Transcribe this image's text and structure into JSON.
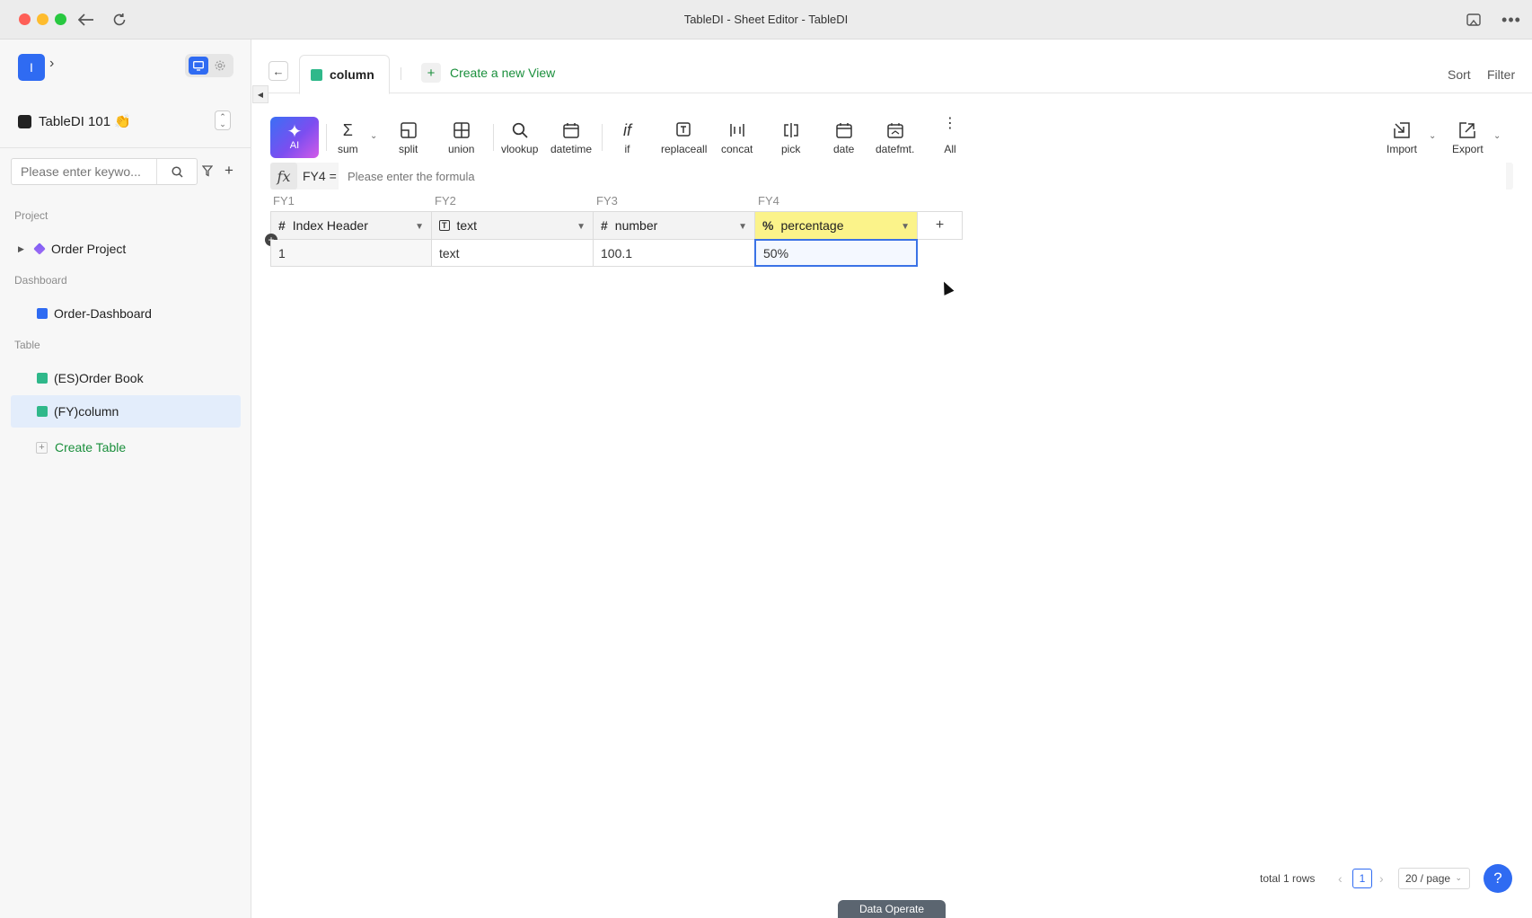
{
  "window": {
    "title": "TableDI - Sheet Editor - TableDI"
  },
  "sidebar": {
    "logo_letter": "I",
    "workspace_name": "TableDI 101 👏",
    "search": {
      "placeholder": "Please enter keywo..."
    },
    "sections": {
      "project": "Project",
      "dashboard": "Dashboard",
      "table": "Table"
    },
    "items": {
      "order_project": "Order Project",
      "order_dashboard": "Order-Dashboard",
      "order_book": "(ES)Order Book",
      "column": "(FY)column",
      "create_table": "Create Table"
    }
  },
  "tabs": {
    "active_label": "column",
    "new_view_label": "Create a new View",
    "sort_label": "Sort",
    "filter_label": "Filter"
  },
  "toolbar": {
    "ai": "AI",
    "tools": {
      "sum": "sum",
      "split": "split",
      "union": "union",
      "vlookup": "vlookup",
      "datetime": "datetime",
      "if": "if",
      "replaceall": "replaceall",
      "concat": "concat",
      "pick": "pick",
      "date": "date",
      "datefmt": "datefmt.",
      "all": "All",
      "import": "Import",
      "export": "Export"
    }
  },
  "formula": {
    "ref": "FY4 =",
    "placeholder": "Please enter the formula"
  },
  "grid": {
    "letters": [
      "FY1",
      "FY2",
      "FY3",
      "FY4"
    ],
    "headers": [
      {
        "type_glyph": "#",
        "name": "Index Header"
      },
      {
        "type_glyph": "T",
        "name": "text"
      },
      {
        "type_glyph": "#",
        "name": "number"
      },
      {
        "type_glyph": "%",
        "name": "percentage"
      }
    ],
    "row1": [
      "1",
      "text",
      "100.1",
      "50%"
    ],
    "add_column": "+"
  },
  "footer": {
    "total": "total 1 rows",
    "page": "1",
    "page_size": "20 / page",
    "help": "?",
    "data_operate": "Data Operate"
  },
  "colors": {
    "accent": "#2f6bf2",
    "green": "#1a8f3c",
    "header_highlight": "#fbf38a"
  }
}
